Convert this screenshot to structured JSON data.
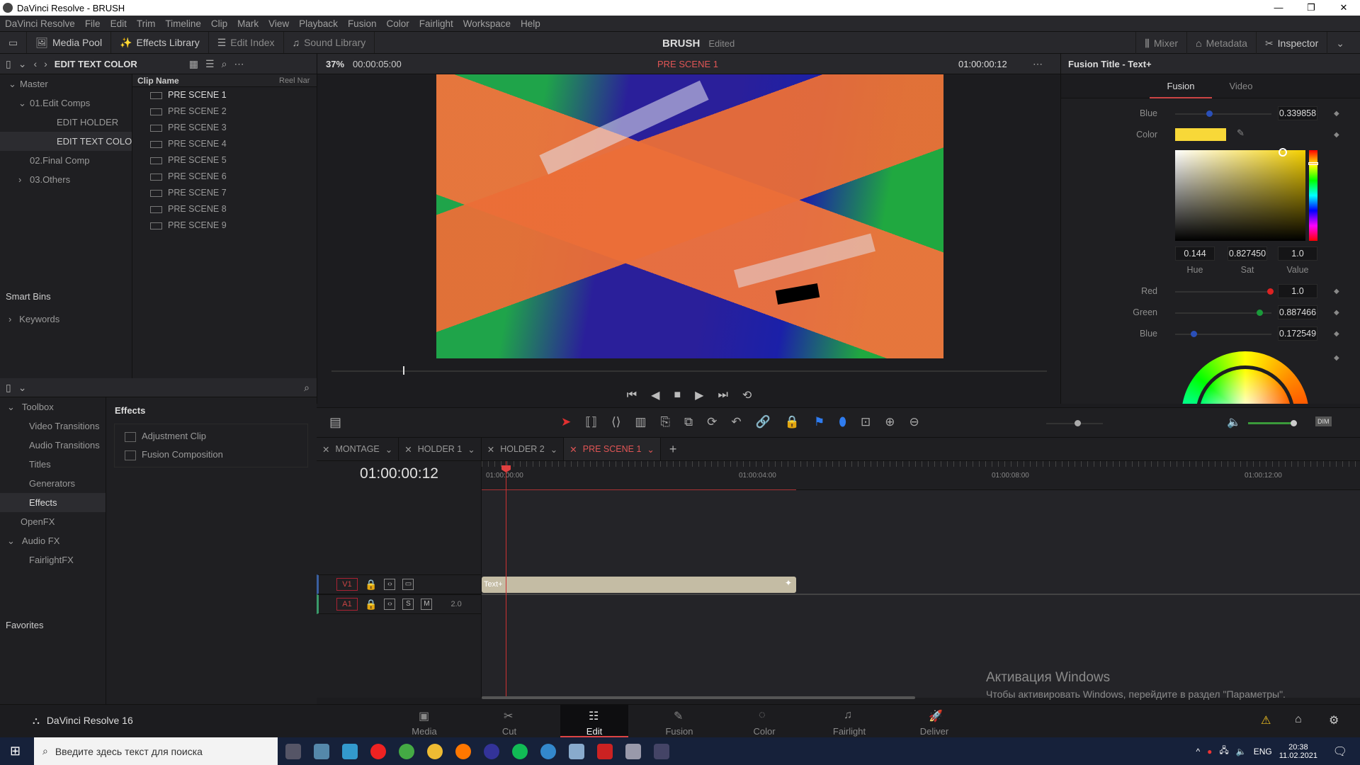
{
  "window": {
    "title": "DaVinci Resolve - BRUSH",
    "controls": [
      "—",
      "❐",
      "✕"
    ]
  },
  "menu": [
    "DaVinci Resolve",
    "File",
    "Edit",
    "Trim",
    "Timeline",
    "Clip",
    "Mark",
    "View",
    "Playback",
    "Fusion",
    "Color",
    "Fairlight",
    "Workspace",
    "Help"
  ],
  "toolbar": {
    "media_pool": "Media Pool",
    "effects_library": "Effects Library",
    "edit_index": "Edit Index",
    "sound_library": "Sound Library",
    "project": "BRUSH",
    "status": "Edited",
    "mixer": "Mixer",
    "metadata": "Metadata",
    "inspector": "Inspector"
  },
  "bins": {
    "current": "EDIT TEXT COLOR",
    "items": [
      {
        "label": "Master",
        "level": 0,
        "arrow": "⌄"
      },
      {
        "label": "01.Edit Comps",
        "level": 1,
        "arrow": "⌄"
      },
      {
        "label": "EDIT HOLDER",
        "level": 2,
        "arrow": ""
      },
      {
        "label": "EDIT TEXT COLOR",
        "level": 2,
        "arrow": "",
        "selected": true
      },
      {
        "label": "02.Final Comp",
        "level": 1,
        "arrow": ""
      },
      {
        "label": "03.Others",
        "level": 1,
        "arrow": "›"
      }
    ],
    "smart_bins": "Smart Bins",
    "keywords": "Keywords"
  },
  "clip_list": {
    "col_name": "Clip Name",
    "col_reel": "Reel Nar",
    "clips": [
      "PRE SCENE 1",
      "PRE SCENE 2",
      "PRE SCENE 3",
      "PRE SCENE 4",
      "PRE SCENE 5",
      "PRE SCENE 6",
      "PRE SCENE 7",
      "PRE SCENE 8",
      "PRE SCENE 9"
    ]
  },
  "viewer": {
    "zoom": "37%",
    "duration": "00:00:05:00",
    "timeline_name": "PRE SCENE 1",
    "timecode": "01:00:00:12",
    "scrub_position": 0.1
  },
  "inspector": {
    "title": "Fusion Title - Text+",
    "tabs": [
      "Fusion",
      "Video"
    ],
    "active_tab": "Fusion",
    "blue_top": {
      "label": "Blue",
      "value": "0.339858",
      "fraction": 0.34
    },
    "color_label": "Color",
    "swatch": "#f8d838",
    "hue": {
      "label": "Hue",
      "value": "0.144"
    },
    "sat": {
      "label": "Sat",
      "value": "0.827450"
    },
    "val": {
      "label": "Value",
      "value": "1.0"
    },
    "red": {
      "label": "Red",
      "value": "1.0",
      "fraction": 1.0
    },
    "green": {
      "label": "Green",
      "value": "0.887466",
      "fraction": 0.887
    },
    "blue": {
      "label": "Blue",
      "value": "0.172549",
      "fraction": 0.17
    }
  },
  "toolbox": {
    "items": [
      {
        "label": "Toolbox",
        "level": 0,
        "arrow": "⌄"
      },
      {
        "label": "Video Transitions",
        "level": 1
      },
      {
        "label": "Audio Transitions",
        "level": 1
      },
      {
        "label": "Titles",
        "level": 1
      },
      {
        "label": "Generators",
        "level": 1
      },
      {
        "label": "Effects",
        "level": 1,
        "selected": true
      },
      {
        "label": "OpenFX",
        "level": 0.5
      },
      {
        "label": "Audio FX",
        "level": 0,
        "arrow": "⌄"
      },
      {
        "label": "FairlightFX",
        "level": 1
      }
    ],
    "favorites": "Favorites"
  },
  "effects_panel": {
    "title": "Effects",
    "items": [
      "Adjustment Clip",
      "Fusion Composition"
    ]
  },
  "timeline": {
    "tabs": [
      {
        "label": "MONTAGE"
      },
      {
        "label": "HOLDER 1"
      },
      {
        "label": "HOLDER 2"
      },
      {
        "label": "PRE SCENE 1",
        "active": true
      }
    ],
    "timecode": "01:00:00:12",
    "ruler": [
      "01:00:00:00",
      "01:00:04:00",
      "01:00:08:00",
      "01:00:12:00"
    ],
    "tracks": {
      "v1": "V1",
      "a1": "A1",
      "a1_channels": "2.0",
      "solo": "S",
      "mute": "M"
    },
    "clip_label": "Text+"
  },
  "pages": [
    "Media",
    "Cut",
    "Edit",
    "Fusion",
    "Color",
    "Fairlight",
    "Deliver"
  ],
  "active_page": "Edit",
  "app_version": "DaVinci Resolve 16",
  "watermark": {
    "line1": "Активация Windows",
    "line2": "Чтобы активировать Windows, перейдите в раздел \"Параметры\"."
  },
  "taskbar": {
    "search_placeholder": "Введите здесь текст для поиска",
    "lang": "ENG",
    "time": "20:38",
    "date": "11.02.2021"
  }
}
